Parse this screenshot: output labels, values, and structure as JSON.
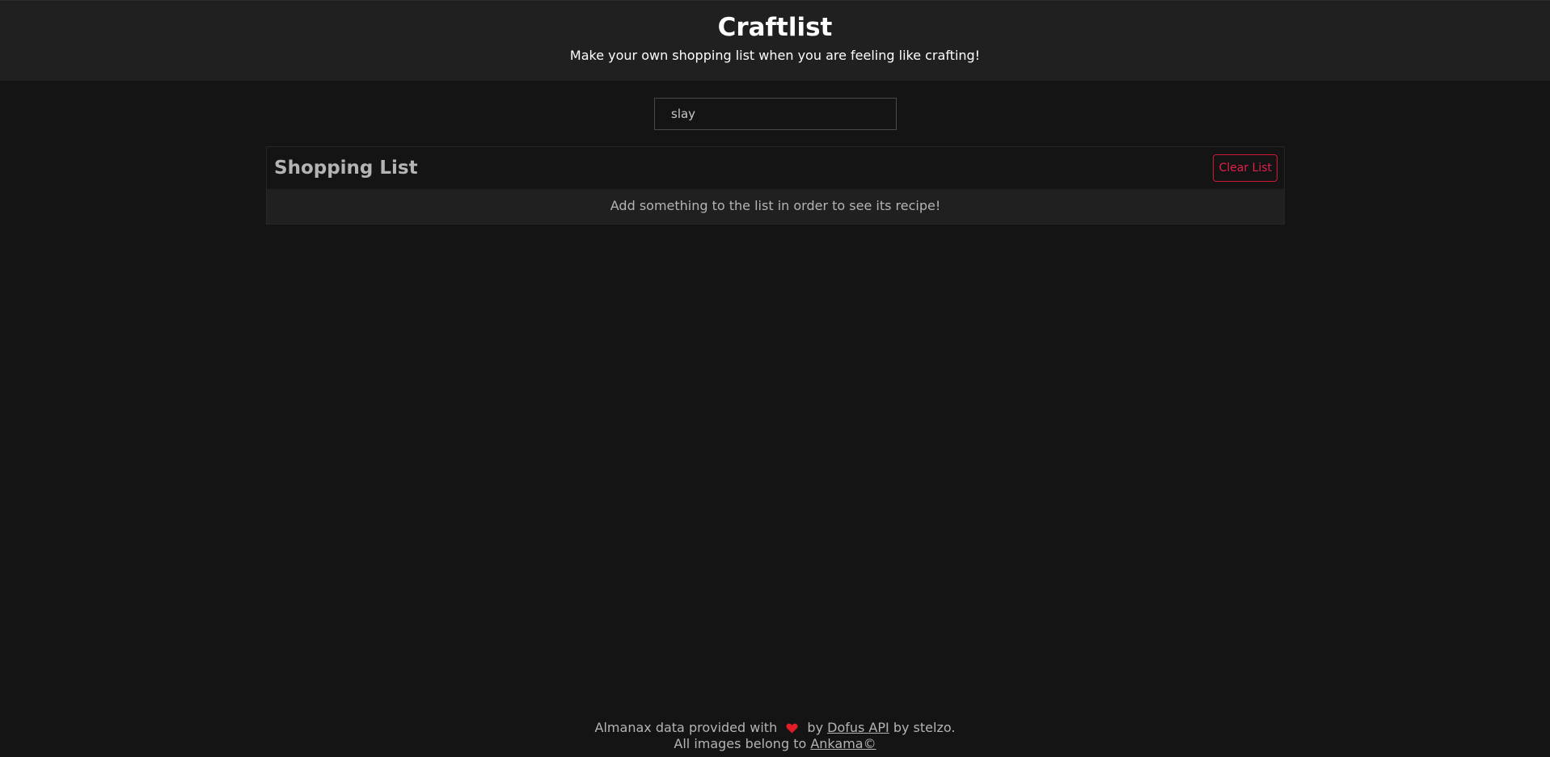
{
  "header": {
    "title": "Craftlist",
    "subtitle": "Make your own shopping list when you are feeling like crafting!"
  },
  "search": {
    "value": "slay",
    "placeholder": ""
  },
  "shopping_list": {
    "title": "Shopping List",
    "clear_button_label": "Clear List",
    "empty_message": "Add something to the list in order to see its recipe!"
  },
  "footer": {
    "line1_prefix": "Almanax data provided with",
    "line1_by": "by",
    "api_link_label": "Dofus API",
    "line1_suffix": "by stelzo.",
    "line2_prefix": "All images belong to",
    "ankama_link_label": "Ankama©"
  },
  "colors": {
    "background": "#141414",
    "header_background": "#202020",
    "accent": "#e0204a",
    "heart": "#e01e28"
  },
  "icons": {
    "heart": "heart-icon"
  }
}
